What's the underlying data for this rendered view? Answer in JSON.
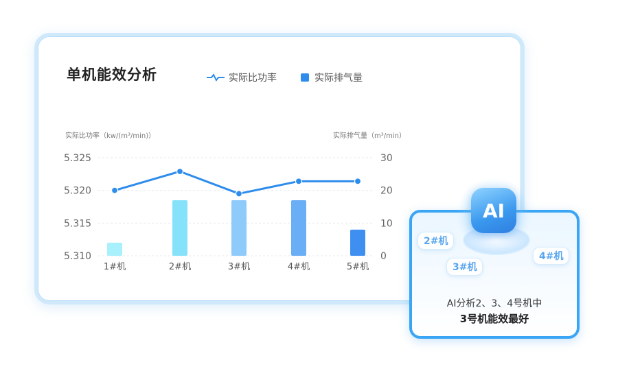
{
  "card": {
    "title": "单机能效分析",
    "legend": {
      "line_label": "实际比功率",
      "bar_label": "实际排气量"
    },
    "left_axis_title": "实际比功率（kw/(m³/min)）",
    "right_axis_title": "实际排气量（m³/min）"
  },
  "chart_data": {
    "type": "bar+line",
    "categories": [
      "1#机",
      "2#机",
      "3#机",
      "4#机",
      "5#机"
    ],
    "series": [
      {
        "name": "实际比功率",
        "type": "line",
        "axis": "left",
        "values": [
          5.32,
          5.3229,
          5.3195,
          5.3214,
          5.3214
        ],
        "color": "#2e8cec"
      },
      {
        "name": "实际排气量",
        "type": "bar",
        "axis": "right",
        "values": [
          4,
          17,
          17,
          17,
          8
        ],
        "colors": [
          "#a8f0fb",
          "#86e2fb",
          "#8ecbfa",
          "#6aaef6",
          "#3f8ff0"
        ]
      }
    ],
    "y_left": {
      "ticks": [
        "5.325",
        "5.320",
        "5.315",
        "5.310"
      ],
      "range": [
        5.31,
        5.325
      ]
    },
    "y_right": {
      "ticks": [
        "30",
        "20",
        "10",
        "0"
      ],
      "range": [
        0,
        30
      ]
    },
    "grid": true
  },
  "ai_panel": {
    "badge": "AI",
    "bubbles": [
      "2#机",
      "3#机",
      "4#机"
    ],
    "line1": "AI分析2、3、4号机中",
    "line2": "3号机能效最好"
  }
}
